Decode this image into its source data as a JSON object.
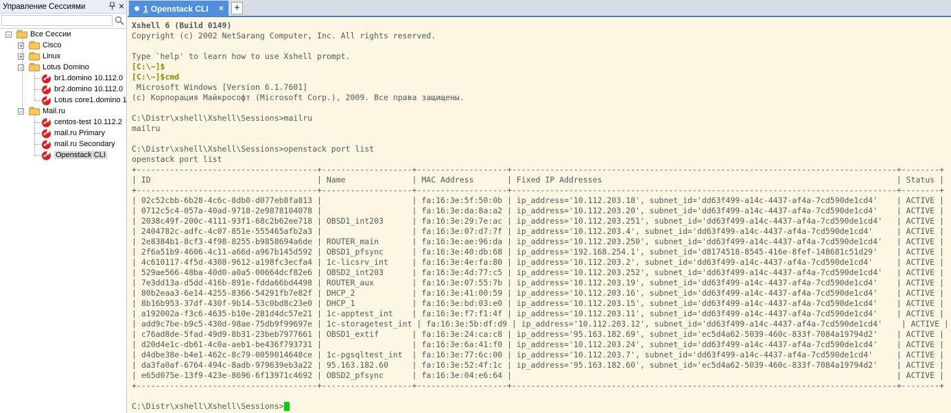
{
  "sidebar": {
    "title": "Управление Сессиями",
    "pin_icon": "pin-icon",
    "close_icon": "close-icon",
    "search": {
      "value": "",
      "placeholder": ""
    },
    "tree": {
      "root": "Все Сессии",
      "folders": [
        {
          "name": "Cisco",
          "expanded": false,
          "sessions": []
        },
        {
          "name": "Linux",
          "expanded": false,
          "sessions": []
        },
        {
          "name": "Lotus Domino",
          "expanded": true,
          "sessions": [
            "br1.domino 10.112.0",
            "br2.domino 10.112.0",
            "Lotus core1.domino 1"
          ]
        },
        {
          "name": "Mail.ru",
          "expanded": true,
          "sessions": [
            "centos-test 10.112.2",
            "mail.ru Primary",
            "mail.ru Secondary",
            "Openstack CLI"
          ]
        }
      ],
      "selected": "Openstack CLI"
    }
  },
  "tabs": [
    {
      "number": "1",
      "label": "Openstack CLI",
      "close": "×",
      "active": true
    }
  ],
  "add_tab_label": "+",
  "colors": {
    "terminal_bg": "#fdf6e3",
    "terminal_fg": "#4f5a5a",
    "prompt": "#7a8f00",
    "tab_active": "#4f8fe0",
    "cursor": "#00d000"
  },
  "terminal": {
    "lines": [
      "Xshell 6 (Build 0149)",
      "Copyright (c) 2002 NetSarang Computer, Inc. All rights reserved.",
      "",
      "Type `help' to learn how to use Xshell prompt.",
      "[C:\\~]$",
      "[C:\\~]$cmd",
      " Microsoft Windows [Version 6.1.7601]",
      "(c) Корпорация Майкрософт (Microsoft Corp.), 2009. Все права защищены.",
      "",
      "C:\\Distr\\xshell\\Xshell\\Sessions>mailru",
      "mailru",
      "",
      "C:\\Distr\\xshell\\Xshell\\Sessions>openstack port list",
      "openstack port list",
      "+--------------------------------------+-------------------+-------------------+---------------------------------------------------------------------------------+--------+",
      "| ID                                   | Name              | MAC Address       | Fixed IP Addresses                                                              | Status |",
      "+--------------------------------------+-------------------+-------------------+---------------------------------------------------------------------------------+--------+",
      "| 02c52cbb-6b28-4c6c-8db0-d077eb8fa813 |                   | fa:16:3e:5f:50:0b | ip_address='10.112.203.18', subnet_id='dd63f499-a14c-4437-af4a-7cd590de1cd4'    | ACTIVE |",
      "| 0712c5c4-057a-40ad-9718-2e9878104078 |                   | fa:16:3e:da:8a:a2 | ip_address='10.112.203.20', subnet_id='dd63f499-a14c-4437-af4a-7cd590de1cd4'    | ACTIVE |",
      "| 2038c49f-200c-4111-93f1-68c2b62ee718 | OBSD1_int203      | fa:16:3e:29:7e:ac | ip_address='10.112.203.251', subnet_id='dd63f499-a14c-4437-af4a-7cd590de1cd4'   | ACTIVE |",
      "| 2404782c-adfc-4c07-851e-555465afb2a3 |                   | fa:16:3e:07:d7:7f | ip_address='10.112.203.4', subnet_id='dd63f499-a14c-4437-af4a-7cd590de1cd4'     | ACTIVE |",
      "| 2e8384b1-8cf3-4f98-8255-b9858694a6de | ROUTER_main       | fa:16:3e:ae:96:da | ip_address='10.112.203.250', subnet_id='dd63f499-a14c-4437-af4a-7cd590de1cd4'   | ACTIVE |",
      "| 2f6a51b9-4606-4c11-a66d-a967b145d592 | OBSD1_pfsync      | fa:16:3e:40:db:68 | ip_address='192.168.254.1', subnet_id='d8174518-8545-416e-8fef-148681c51d29'    | ACTIVE |",
      "| 4c610117-4f5d-4308-9612-a198fc3ecfa4 | 1c-licsrv_int     | fa:16:3e:4e:fa:80 | ip_address='10.112.203.2', subnet_id='dd63f499-a14c-4437-af4a-7cd590de1cd4'     | ACTIVE |",
      "| 529ae566-48ba-40d0-a0a5-00664dcf82e6 | OBSD2_int203      | fa:16:3e:4d:77:c5 | ip_address='10.112.203.252', subnet_id='dd63f499-a14c-4437-af4a-7cd590de1cd4'   | ACTIVE |",
      "| 7e3dd13a-d5dd-416b-891e-fdda66bd4498 | ROUTER_aux        | fa:16:3e:07:55:7b | ip_address='10.112.203.19', subnet_id='dd63f499-a14c-4437-af4a-7cd590de1cd4'    | ACTIVE |",
      "| 80b2eaa3-6e14-4255-8366-54291fb7e82f | DHCP_2            | fa:16:3e:41:00:59 | ip_address='10.112.203.16', subnet_id='dd63f499-a14c-4437-af4a-7cd590de1cd4'    | ACTIVE |",
      "| 8b16b953-37df-430f-9b14-53c0bd8c23e0 | DHCP_1            | fa:16:3e:bd:03:e0 | ip_address='10.112.203.15', subnet_id='dd63f499-a14c-4437-af4a-7cd590de1cd4'    | ACTIVE |",
      "| a192002a-f3c6-4635-b10e-281d4dc57e21 | 1c-apptest_int    | fa:16:3e:f7:f1:4f | ip_address='10.112.203.11', subnet_id='dd63f499-a14c-4437-af4a-7cd590de1cd4'    | ACTIVE |",
      "| add9c7be-b9c5-430d-98ae-75db9f99697e | 1c-storagetest_int | fa:16:3e:5b:df:d9 | ip_address='10.112.203.12', subnet_id='dd63f499-a14c-4437-af4a-7cd590de1cd4'    | ACTIVE |",
      "| c76ad8de-5fad-49d9-8b31-23beb7977661 | OBSD1_extif       | fa:16:3e:24:ca:c8 | ip_address='95.163.182.69', subnet_id='ec5d4a62-5039-460c-833f-7084a19794d2'    | ACTIVE |",
      "| d20d4e1c-db61-4c0a-aeb1-be436f793731 |                   | fa:16:3e:6a:41:f0 | ip_address='10.112.203.24', subnet_id='dd63f499-a14c-4437-af4a-7cd590de1cd4'    | ACTIVE |",
      "| d4dbe38e-b4e1-462c-8c79-0059014648ce | 1c-pgsqltest_int  | fa:16:3e:77:6c:00 | ip_address='10.112.203.7', subnet_id='dd63f499-a14c-4437-af4a-7cd590de1cd4'     | ACTIVE |",
      "| da3fa0af-6764-494c-8adb-979639eb3a22 | 95.163.182.60     | fa:16:3e:52:4f:1c | ip_address='95.163.182.60', subnet_id='ec5d4a62-5039-460c-833f-7084a19794d2'    | ACTIVE |",
      "| e65d075e-13f9-423e-8696-6f13971c4692 | OBSD2_pfsync      | fa:16:3e:04:e6:64 |                                                                                 | ACTIVE |",
      "+--------------------------------------+-------------------+-------------------+---------------------------------------------------------------------------------+--------+",
      "",
      "C:\\Distr\\xshell\\Xshell\\Sessions>"
    ]
  }
}
